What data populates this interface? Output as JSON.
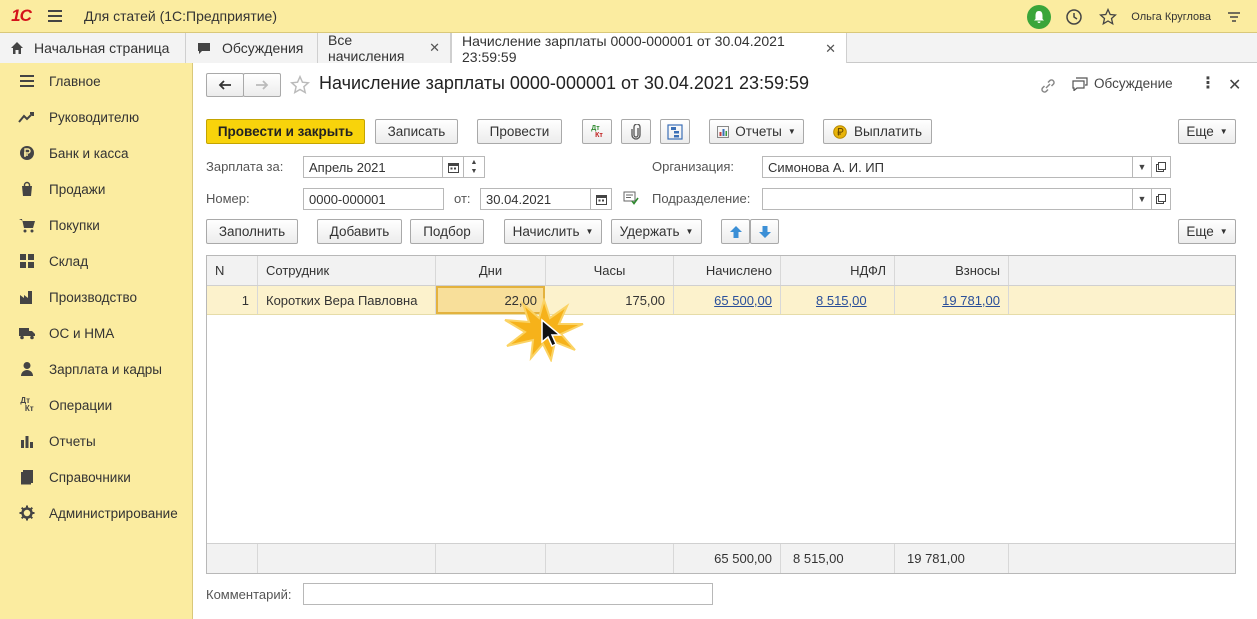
{
  "titlebar": {
    "logo": "1С",
    "title": "Для статей  (1С:Предприятие)",
    "user": "Ольга Круглова"
  },
  "tabs": [
    {
      "label": "Начальная страница"
    },
    {
      "label": "Обсуждения"
    },
    {
      "label": "Все начисления"
    },
    {
      "label": "Начисление зарплаты 0000-000001 от 30.04.2021 23:59:59"
    }
  ],
  "sidebar": {
    "items": [
      {
        "label": "Главное",
        "icon": "menu-lines-icon"
      },
      {
        "label": "Руководителю",
        "icon": "trend-icon"
      },
      {
        "label": "Банк и касса",
        "icon": "ruble-coin-icon"
      },
      {
        "label": "Продажи",
        "icon": "shopping-bag-icon"
      },
      {
        "label": "Покупки",
        "icon": "cart-icon"
      },
      {
        "label": "Склад",
        "icon": "warehouse-icon"
      },
      {
        "label": "Производство",
        "icon": "factory-icon"
      },
      {
        "label": "ОС и НМА",
        "icon": "truck-icon"
      },
      {
        "label": "Зарплата и кадры",
        "icon": "person-icon"
      },
      {
        "label": "Операции",
        "icon": "dt-kt-icon"
      },
      {
        "label": "Отчеты",
        "icon": "bar-chart-icon"
      },
      {
        "label": "Справочники",
        "icon": "books-icon"
      },
      {
        "label": "Администрирование",
        "icon": "gear-icon"
      }
    ]
  },
  "document": {
    "title": "Начисление зарплаты 0000-000001 от 30.04.2021 23:59:59",
    "discussion_label": "Обсуждение"
  },
  "toolbar": {
    "post_close": "Провести и закрыть",
    "save": "Записать",
    "post": "Провести",
    "dtkt": "Дт Кт",
    "reports": "Отчеты",
    "pay": "Выплатить",
    "more": "Еще"
  },
  "form": {
    "salary_for_label": "Зарплата за:",
    "salary_for_value": "Апрель 2021",
    "org_label": "Организация:",
    "org_value": "Симонова А. И. ИП",
    "number_label": "Номер:",
    "number_value": "0000-000001",
    "date_label": "от:",
    "date_value": "30.04.2021",
    "division_label": "Подразделение:",
    "division_value": "",
    "comment_label": "Комментарий:",
    "comment_value": ""
  },
  "table_toolbar": {
    "fill": "Заполнить",
    "add": "Добавить",
    "select": "Подбор",
    "accrue": "Начислить",
    "withhold": "Удержать",
    "more": "Еще"
  },
  "table": {
    "columns": [
      "N",
      "Сотрудник",
      "Дни",
      "Часы",
      "Начислено",
      "НДФЛ",
      "Взносы"
    ],
    "rows": [
      {
        "n": "1",
        "employee": "Коротких Вера Павловна",
        "days": "22,00",
        "hours": "175,00",
        "accrued": "65 500,00",
        "ndfl": "8 515,00",
        "contrib": "19 781,00"
      }
    ],
    "totals": {
      "accrued": "65 500,00",
      "ndfl": "8 515,00",
      "contrib": "19 781,00"
    }
  },
  "colors": {
    "sidebar_bg": "#fbeca0",
    "primary_button": "#f8d30b",
    "selected_row": "#fcf2cc",
    "link": "#2a4f9a"
  }
}
